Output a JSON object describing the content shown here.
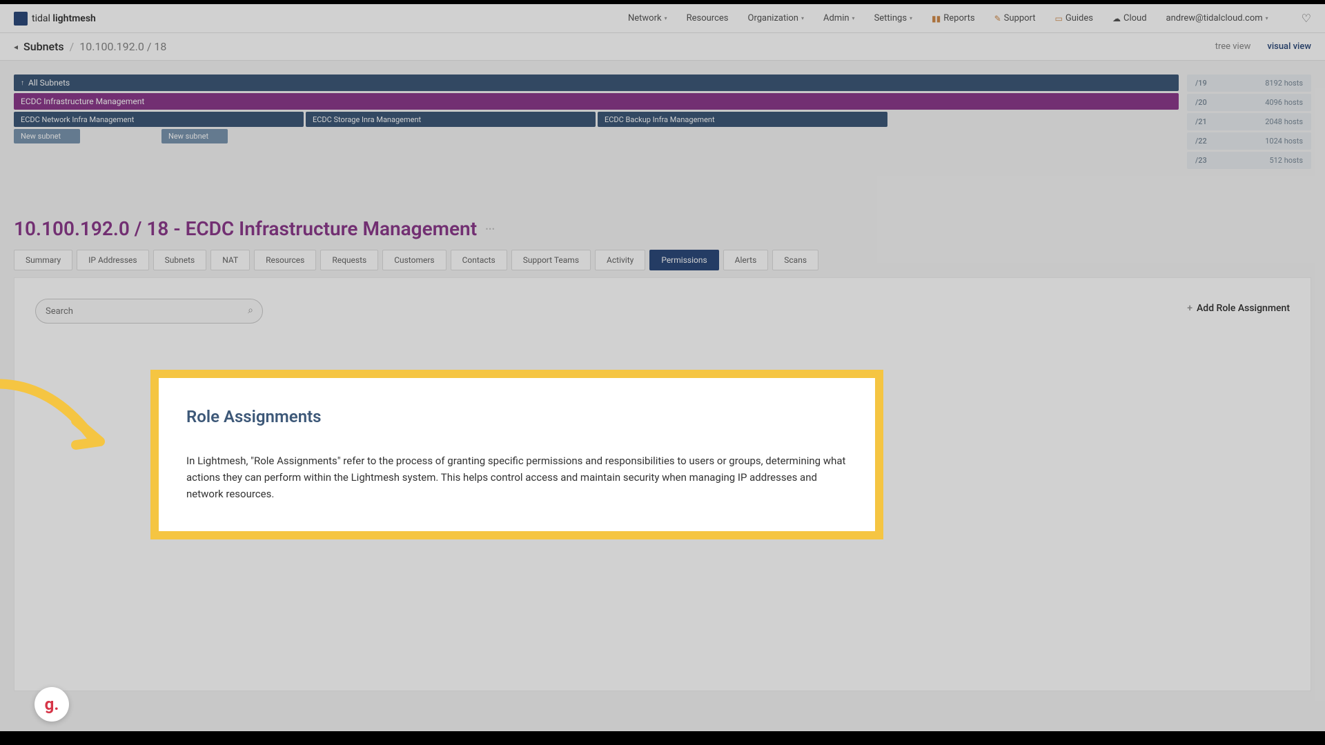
{
  "logo": {
    "thin": "tidal",
    "bold": "lightmesh"
  },
  "nav": [
    {
      "label": "Network",
      "dropdown": true
    },
    {
      "label": "Resources",
      "dropdown": false
    },
    {
      "label": "Organization",
      "dropdown": true
    },
    {
      "label": "Admin",
      "dropdown": true
    },
    {
      "label": "Settings",
      "dropdown": true
    }
  ],
  "nav_right": [
    {
      "label": "Reports",
      "icon": "bar"
    },
    {
      "label": "Support",
      "icon": "wrench"
    },
    {
      "label": "Guides",
      "icon": "book"
    },
    {
      "label": "Cloud",
      "icon": "cloud"
    }
  ],
  "user_email": "andrew@tidalcloud.com",
  "breadcrumb": {
    "root": "Subnets",
    "current": "10.100.192.0 / 18"
  },
  "views": {
    "tree": "tree view",
    "visual": "visual view"
  },
  "strips": {
    "all": "All Subnets",
    "ecdc": "ECDC Infrastructure Management",
    "subs": [
      "ECDC Network Infra Management",
      "ECDC Storage Inra Management",
      "ECDC Backup Infra Management"
    ],
    "new_label": "New subnet"
  },
  "cidrs": [
    {
      "cidr": "/19",
      "hosts": "8192 hosts"
    },
    {
      "cidr": "/20",
      "hosts": "4096 hosts"
    },
    {
      "cidr": "/21",
      "hosts": "2048 hosts"
    },
    {
      "cidr": "/22",
      "hosts": "1024 hosts"
    },
    {
      "cidr": "/23",
      "hosts": "512 hosts"
    }
  ],
  "page_title": "10.100.192.0 / 18 - ECDC Infrastructure Management",
  "tabs": [
    "Summary",
    "IP Addresses",
    "Subnets",
    "NAT",
    "Resources",
    "Requests",
    "Customers",
    "Contacts",
    "Support Teams",
    "Activity",
    "Permissions",
    "Alerts",
    "Scans"
  ],
  "active_tab": "Permissions",
  "search_placeholder": "Search",
  "add_role_label": "Add Role Assignment",
  "callout": {
    "title": "Role Assignments",
    "body": "In Lightmesh, \"Role Assignments\" refer to the process of granting specific permissions and responsibilities to users or groups, determining what actions they can perform within the Lightmesh system. This helps control access and maintain security when managing IP addresses and network resources."
  },
  "floating_g": "g."
}
